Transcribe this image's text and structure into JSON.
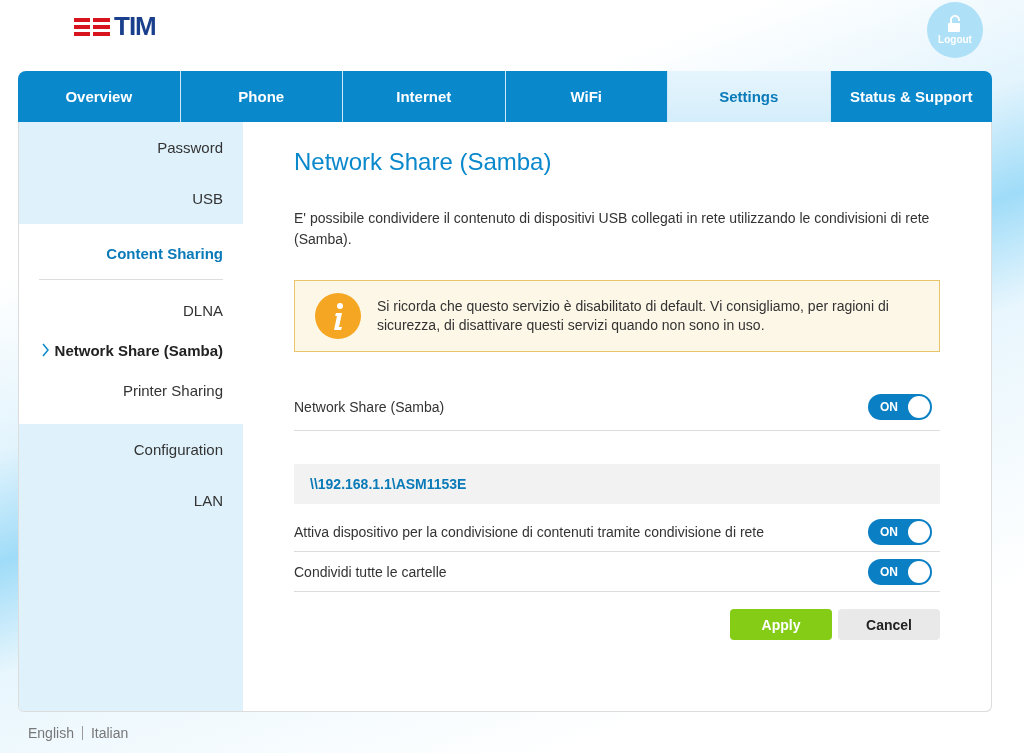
{
  "header": {
    "logo": "TIM",
    "logout": "Logout"
  },
  "tabs": [
    {
      "label": "Overview",
      "selected": false
    },
    {
      "label": "Phone",
      "selected": false
    },
    {
      "label": "Internet",
      "selected": false
    },
    {
      "label": "WiFi",
      "selected": false
    },
    {
      "label": "Settings",
      "selected": true
    },
    {
      "label": "Status & Support",
      "selected": false
    }
  ],
  "sidebar": {
    "items": [
      {
        "label": "Password",
        "selected": false,
        "expanded": false
      },
      {
        "label": "USB",
        "selected": false,
        "expanded": false
      },
      {
        "label": "Content Sharing",
        "selected": true,
        "expanded": true,
        "children": [
          {
            "label": "DLNA",
            "selected": false
          },
          {
            "label": "Network Share (Samba)",
            "selected": true
          },
          {
            "label": "Printer Sharing",
            "selected": false
          }
        ]
      },
      {
        "label": "Configuration",
        "selected": false,
        "expanded": false
      },
      {
        "label": "LAN",
        "selected": false,
        "expanded": false
      }
    ]
  },
  "content": {
    "title": "Network Share (Samba)",
    "description": "E' possibile condividere il contenuto di dispositivi USB collegati in rete utilizzando le condivisioni di rete (Samba).",
    "notice": "Si ricorda che questo servizio è disabilitato di default. Vi consigliamo, per ragioni di sicurezza, di disattivare questi servizi quando non sono in uso.",
    "main_toggle": {
      "label": "Network Share (Samba)",
      "on": true,
      "state_label": "ON"
    },
    "share_path": "\\\\192.168.1.1\\ASM1153E",
    "options": [
      {
        "label": "Attiva dispositivo per la condivisione di contenuti tramite condivisione di rete",
        "on": true,
        "state_label": "ON"
      },
      {
        "label": "Condividi tutte le cartelle",
        "on": true,
        "state_label": "ON"
      }
    ],
    "buttons": [
      {
        "label": "Apply",
        "kind": "primary"
      },
      {
        "label": "Cancel",
        "kind": "secondary"
      }
    ]
  },
  "footer": {
    "languages": [
      "English",
      "Italian"
    ]
  }
}
